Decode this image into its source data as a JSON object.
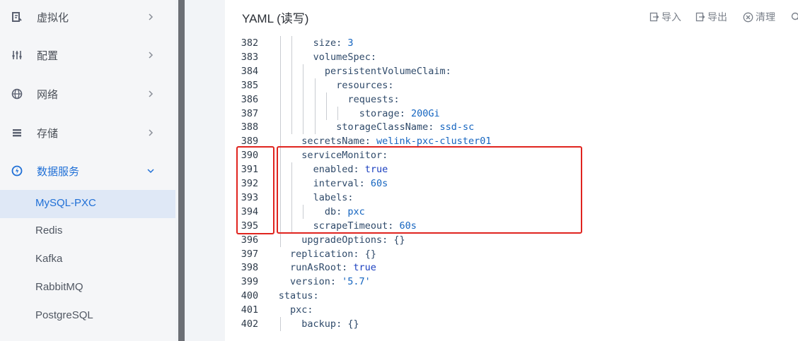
{
  "sidebar": {
    "items": [
      {
        "label": "虚拟化",
        "icon": "virtualization-icon"
      },
      {
        "label": "配置",
        "icon": "config-sliders-icon"
      },
      {
        "label": "网络",
        "icon": "globe-icon"
      },
      {
        "label": "存储",
        "icon": "storage-icon"
      },
      {
        "label": "数据服务",
        "icon": "data-service-icon"
      }
    ],
    "sub_items": [
      {
        "label": "MySQL-PXC",
        "selected": true
      },
      {
        "label": "Redis"
      },
      {
        "label": "Kafka"
      },
      {
        "label": "RabbitMQ"
      },
      {
        "label": "PostgreSQL"
      }
    ]
  },
  "panel": {
    "title": "YAML (读写)",
    "tools": {
      "import": "导入",
      "export": "导出",
      "clear": "清理"
    }
  },
  "editor": {
    "lines": [
      {
        "n": "382",
        "key": "size",
        "val": "3",
        "vt": "v"
      },
      {
        "n": "383",
        "key": "volumeSpec",
        "val": ""
      },
      {
        "n": "384",
        "key": "persistentVolumeClaim",
        "val": ""
      },
      {
        "n": "385",
        "key": "resources",
        "val": ""
      },
      {
        "n": "386",
        "key": "requests",
        "val": ""
      },
      {
        "n": "387",
        "key": "storage",
        "val": "200Gi",
        "vt": "v"
      },
      {
        "n": "388",
        "key": "storageClassName",
        "val": "ssd-sc",
        "vt": "v"
      },
      {
        "n": "389",
        "key": "secretsName",
        "val": "welink-pxc-cluster01",
        "vt": "v"
      },
      {
        "n": "390",
        "key": "serviceMonitor",
        "val": ""
      },
      {
        "n": "391",
        "key": "enabled",
        "val": "true",
        "vt": "vb"
      },
      {
        "n": "392",
        "key": "interval",
        "val": "60s",
        "vt": "v"
      },
      {
        "n": "393",
        "key": "labels",
        "val": ""
      },
      {
        "n": "394",
        "key": "db",
        "val": "pxc",
        "vt": "v"
      },
      {
        "n": "395",
        "key": "scrapeTimeout",
        "val": "60s",
        "vt": "v"
      },
      {
        "n": "396",
        "key": "upgradeOptions",
        "val": "{}",
        "vt": "p"
      },
      {
        "n": "397",
        "key": "replication",
        "val": "{}",
        "vt": "p"
      },
      {
        "n": "398",
        "key": "runAsRoot",
        "val": "true",
        "vt": "vb"
      },
      {
        "n": "399",
        "key": "version",
        "val": "'5.7'",
        "vt": "v"
      },
      {
        "n": "400",
        "key": "status",
        "val": ""
      },
      {
        "n": "401",
        "key": "pxc",
        "val": ""
      },
      {
        "n": "402",
        "key": "backup",
        "val": "{}",
        "vt": "p"
      }
    ]
  },
  "colors": {
    "accent": "#1f6fd6",
    "highlight_box": "#e0241f"
  }
}
